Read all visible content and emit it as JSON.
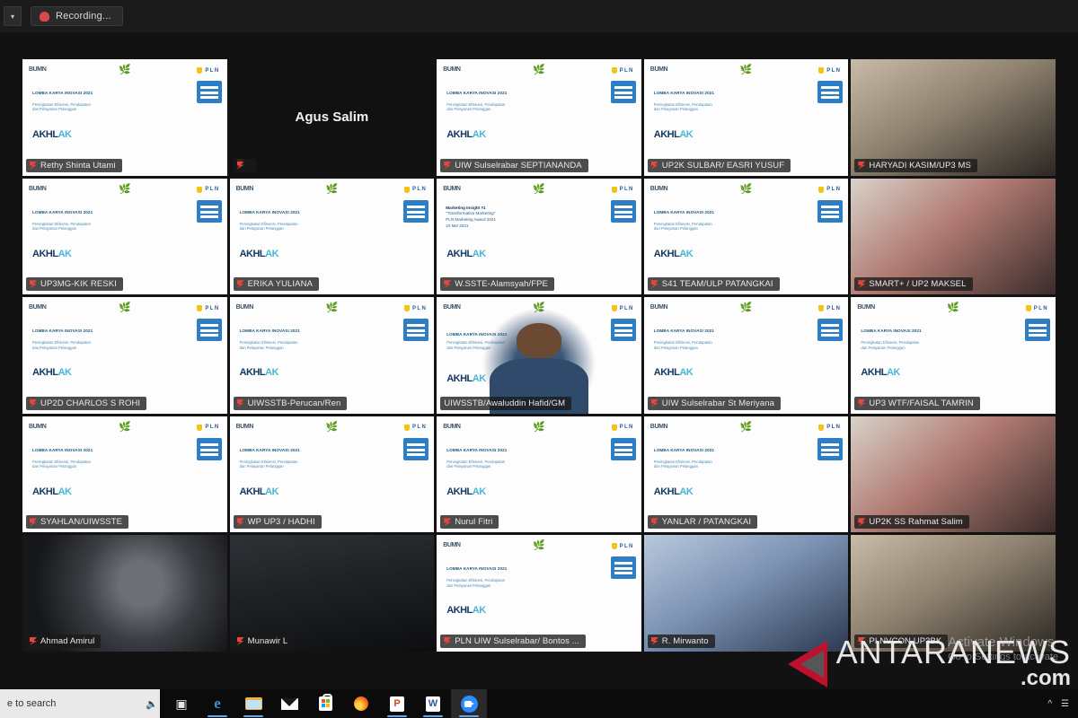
{
  "window": {
    "topbar": {
      "recording_label": "Recording...",
      "caret_icon": "chevron-down-icon",
      "record_icon": "record-dot-icon"
    }
  },
  "slide": {
    "bumn_logo": "BUMN",
    "leaf_icon": "leaf-icon",
    "pln_wordmark": "PLN",
    "title": "LOMBA KARYA INOVASI 2021",
    "subtitle_line1": "Peningkatan Efisiensi, Pendapatan",
    "subtitle_line2": "dan Pelayanan Pelanggan",
    "akhlak_a": "AKHL",
    "akhlak_b": "AK"
  },
  "marketing_slide": {
    "line1": "Marketing Insight #1",
    "line2": "\"Transformative Marketing\"",
    "line3": "PLN Marketing Award 2021",
    "line4": "24 Mei 2021"
  },
  "gallery": {
    "tiles": [
      {
        "name": "Rethy Shinta Utami",
        "kind": "slide",
        "muted": true
      },
      {
        "name": "Agus Salim",
        "kind": "name-only",
        "muted": true
      },
      {
        "name": "UIW Sulselrabar SEPTIANANDA",
        "kind": "slide",
        "muted": true
      },
      {
        "name": "UP2K SULBAR/ EASRI YUSUF",
        "kind": "slide",
        "muted": true
      },
      {
        "name": "HARYADI KASIM/UP3 MS",
        "kind": "video",
        "muted": true
      },
      {
        "name": "UP3MG-KIK RESKI",
        "kind": "slide",
        "muted": true
      },
      {
        "name": "ERIKA YULIANA",
        "kind": "slide",
        "muted": true
      },
      {
        "name": "W.SSTE-Alamsyah/FPE",
        "kind": "marketing",
        "muted": true
      },
      {
        "name": "S41 TEAM/ULP PATANGKAI",
        "kind": "slide",
        "muted": true
      },
      {
        "name": "SMART+ / UP2 MAKSEL",
        "kind": "video",
        "muted": true
      },
      {
        "name": "UP2D CHARLOS S ROHI",
        "kind": "slide",
        "muted": true
      },
      {
        "name": "UIWSSTB-Perucan/Ren",
        "kind": "slide",
        "muted": true
      },
      {
        "name": "UIWSSTB/Awaluddin Hafid/GM",
        "kind": "video-active",
        "muted": false
      },
      {
        "name": "UIW Sulselrabar St Meriyana",
        "kind": "slide",
        "muted": true
      },
      {
        "name": "UP3 WTF/FAISAL TAMRIN",
        "kind": "slide",
        "muted": true
      },
      {
        "name": "SYAHLAN/UIWSSTE",
        "kind": "slide",
        "muted": true
      },
      {
        "name": "WP UP3 / HADHI",
        "kind": "slide",
        "muted": true
      },
      {
        "name": "Nurul Fitri",
        "kind": "slide",
        "muted": true
      },
      {
        "name": "YANLAR / PATANGKAI",
        "kind": "slide",
        "muted": true
      },
      {
        "name": "UP2K SS Rahmat Salim",
        "kind": "video",
        "muted": true
      },
      {
        "name": "Ahmad Amirul",
        "kind": "video",
        "muted": true
      },
      {
        "name": "Munawir L",
        "kind": "video",
        "muted": true
      },
      {
        "name": "PLN UIW Sulselrabar/ Bontos ...",
        "kind": "slide",
        "muted": true
      },
      {
        "name": "R. Mirwanto",
        "kind": "video",
        "muted": true
      },
      {
        "name": "PLNVCON UP3BK",
        "kind": "video",
        "muted": true
      }
    ]
  },
  "watermark": {
    "brand": "ANTARANEWS",
    "suffix": ".com",
    "triangle_icon": "antara-triangle-icon"
  },
  "activate_windows": {
    "title": "Activate Windows",
    "subtitle": "Go to Settings to activate"
  },
  "taskbar": {
    "search_text": "e to search",
    "mic_icon": "microphone-icon",
    "items": [
      {
        "icon": "task-view-icon",
        "label": "Task View"
      },
      {
        "icon": "edge-icon",
        "label": "Microsoft Edge"
      },
      {
        "icon": "file-explorer-icon",
        "label": "File Explorer"
      },
      {
        "icon": "mail-icon",
        "label": "Mail"
      },
      {
        "icon": "microsoft-store-icon",
        "label": "Microsoft Store"
      },
      {
        "icon": "firefox-icon",
        "label": "Firefox"
      },
      {
        "icon": "powerpoint-icon",
        "label": "PowerPoint"
      },
      {
        "icon": "word-icon",
        "label": "Word"
      },
      {
        "icon": "zoom-icon",
        "label": "Zoom"
      }
    ]
  },
  "colors": {
    "accent": "#d6ee4a",
    "zoom_blue": "#2d8cff",
    "record_red": "#d84a4a",
    "antara_red": "#c8102e"
  }
}
